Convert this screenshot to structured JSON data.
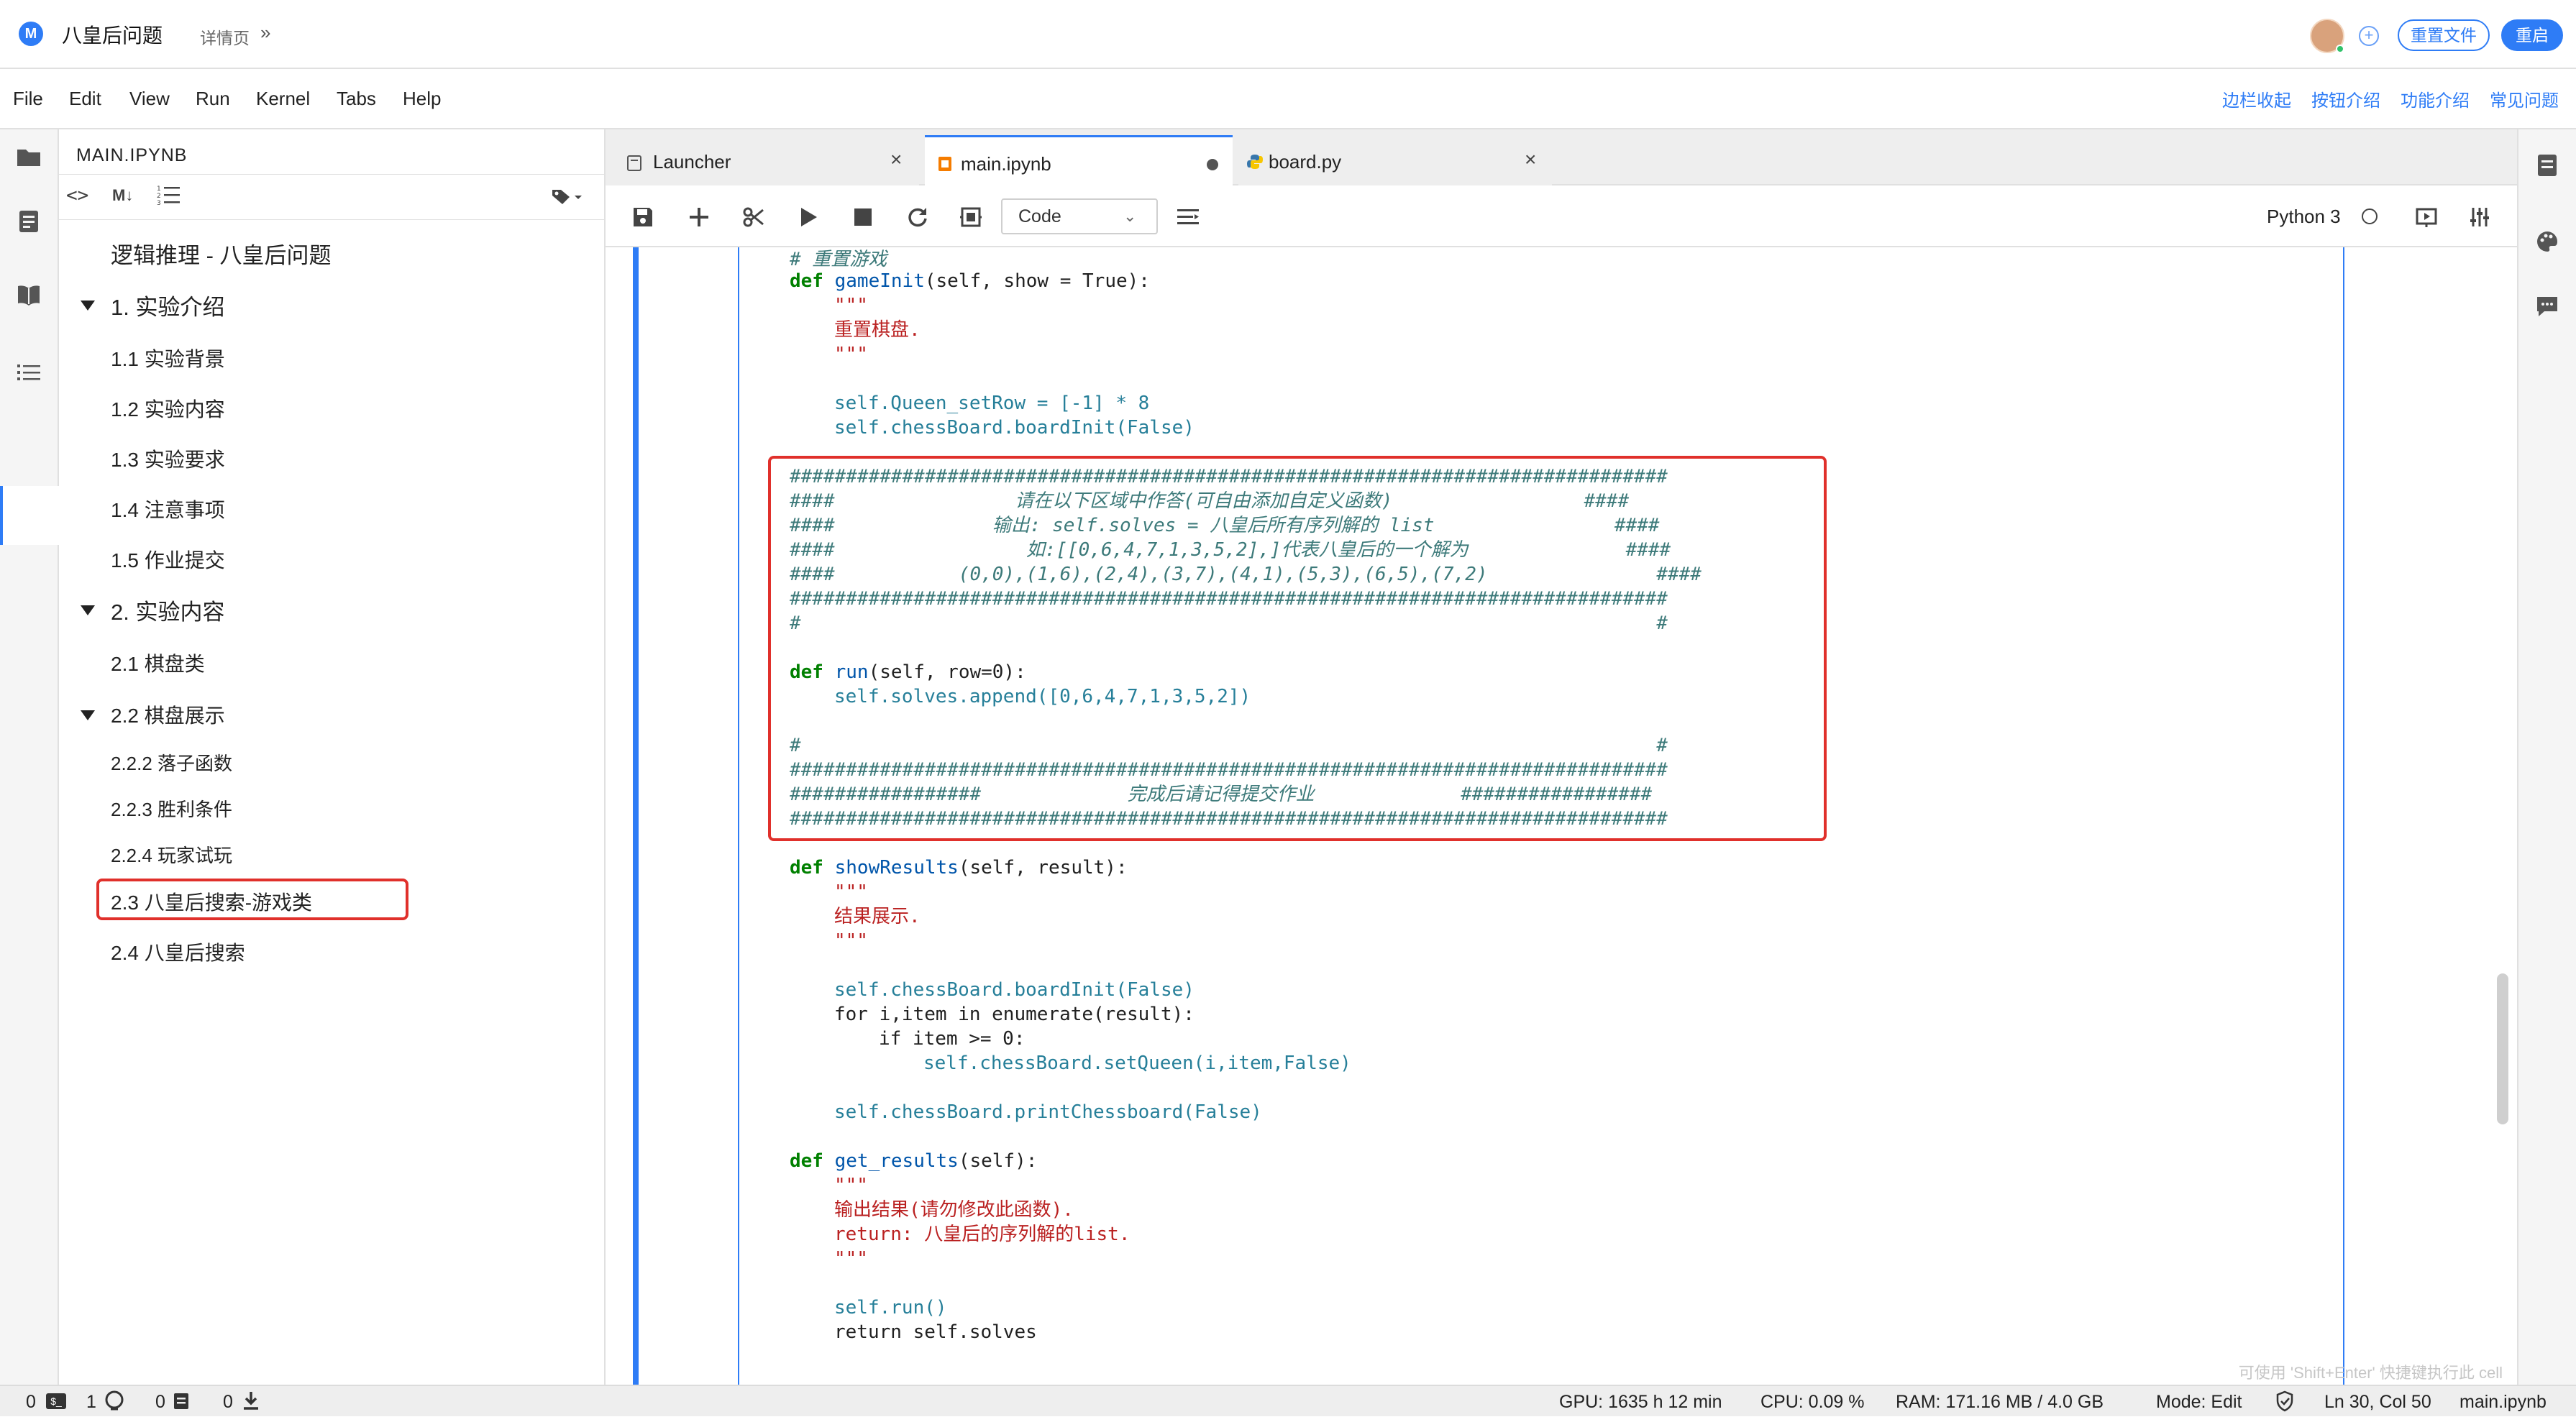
{
  "header": {
    "logo_letter": "M",
    "app_title": "八皇后问题",
    "breadcrumb": "详情页",
    "breadcrumb_arrow": "»",
    "plus_icon": "⊕",
    "reset_label": "重置文件",
    "restart_label": "重启"
  },
  "menu": {
    "items": [
      "File",
      "Edit",
      "View",
      "Run",
      "Kernel",
      "Tabs",
      "Help"
    ],
    "right_links": [
      "边栏收起",
      "按钮介绍",
      "功能介绍",
      "常见问题"
    ]
  },
  "toc": {
    "title": "MAIN.IPYNB",
    "items": [
      {
        "label": "逻辑推理 - 八皇后问题"
      },
      {
        "label": "1. 实验介绍"
      },
      {
        "label": "1.1 实验背景"
      },
      {
        "label": "1.2 实验内容"
      },
      {
        "label": "1.3 实验要求"
      },
      {
        "label": "1.4 注意事项"
      },
      {
        "label": "1.5 作业提交"
      },
      {
        "label": "2. 实验内容"
      },
      {
        "label": "2.1 棋盘类"
      },
      {
        "label": "2.2 棋盘展示"
      },
      {
        "label": "2.2.2 落子函数"
      },
      {
        "label": "2.2.3 胜利条件"
      },
      {
        "label": "2.2.4 玩家试玩"
      },
      {
        "label": "2.3 八皇后搜索-游戏类"
      },
      {
        "label": "2.4 八皇后搜索"
      }
    ]
  },
  "tabs": [
    {
      "label": "Launcher",
      "icon": "launcher-icon"
    },
    {
      "label": "main.ipynb",
      "icon": "notebook-icon",
      "modified": true
    },
    {
      "label": "board.py",
      "icon": "python-icon"
    }
  ],
  "toolbar": {
    "cell_type": "Code",
    "kernel_name": "Python 3"
  },
  "code": {
    "l01": "# 重置游戏",
    "l02_def": "def",
    "l02_name": "gameInit",
    "l02_rest": "(self, show = True):",
    "l03": "\"\"\"",
    "l04": "重置棋盘.",
    "l05": "\"\"\"",
    "l06": "self.Queen_setRow = [-1] * 8",
    "l07": "self.chessBoard.boardInit(False)",
    "b01": "##############################################################################",
    "b02": "####                请在以下区域中作答(可自由添加自定义函数)                 ####",
    "b03": "####              输出: self.solves = 八皇后所有序列解的 list                ####",
    "b04": "####                 如:[[0,6,4,7,1,3,5,2],]代表八皇后的一个解为              ####",
    "b05": "####           (0,0),(1,6),(2,4),(3,7),(4,1),(5,3),(6,5),(7,2)               ####",
    "b06": "##############################################################################",
    "b07": "#                                                                            #",
    "b08_def": "def",
    "b08_name": "run",
    "b08_rest": "(self, row=0):",
    "b09": "self.solves.append([0,6,4,7,1,3,5,2])",
    "b10": "#                                                                            #",
    "b11": "##############################################################################",
    "b12": "#################             完成后请记得提交作业             #################",
    "b13": "##############################################################################",
    "s01_def": "def",
    "s01_name": "showResults",
    "s01_rest": "(self, result):",
    "s02": "\"\"\"",
    "s03": "结果展示.",
    "s04": "\"\"\"",
    "s05": "self.chessBoard.boardInit(False)",
    "s06": "for i,item in enumerate(result):",
    "s07": "if item >= 0:",
    "s08": "self.chessBoard.setQueen(i,item,False)",
    "s09": "self.chessBoard.printChessboard(False)",
    "g01_def": "def",
    "g01_name": "get_results",
    "g01_rest": "(self):",
    "g02": "\"\"\"",
    "g03": "输出结果(请勿修改此函数).",
    "g04": "return: 八皇后的序列解的list.",
    "g05": "\"\"\"",
    "g06": "self.run()",
    "g07": "return self.solves",
    "hint": "可使用 'Shift+Enter' 快捷键执行此 cell"
  },
  "status": {
    "terminals": "0",
    "kernels": "1",
    "docs": "0",
    "downloads": "0",
    "gpu": "GPU: 1635 h 12 min",
    "cpu": "CPU: 0.09 %",
    "ram": "RAM: 171.16 MB / 4.0 GB",
    "mode": "Mode: Edit",
    "position": "Ln 30, Col 50",
    "file": "main.ipynb"
  },
  "colors": {
    "accent": "#2e7cf6",
    "highlight_red": "#e0302b",
    "keyword_green": "#008000",
    "string_red": "#ba2121"
  }
}
